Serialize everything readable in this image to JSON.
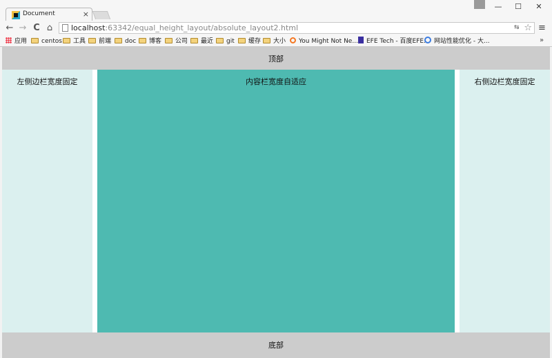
{
  "browser": {
    "tab_title": "Document",
    "tab_close": "×",
    "window_controls": {
      "minimize": "—",
      "maximize": "☐",
      "close": "✕"
    },
    "url_host": "localhost",
    "url_rest": ":63342/equal_height_layout/absolute_layout2.html",
    "nav": {
      "back": "←",
      "forward": "→",
      "reload": "C",
      "home": "⌂"
    },
    "star": "☆",
    "translate": "⇆",
    "menu": "≡",
    "bookmarks_overflow": "»"
  },
  "bookmarks": [
    {
      "label": "应用",
      "icon": "apps-grid-icon"
    },
    {
      "label": "centos",
      "icon": "folder-icon"
    },
    {
      "label": "工具",
      "icon": "folder-icon"
    },
    {
      "label": "前端",
      "icon": "folder-icon"
    },
    {
      "label": "doc",
      "icon": "folder-icon"
    },
    {
      "label": "博客",
      "icon": "folder-icon"
    },
    {
      "label": "公司",
      "icon": "folder-icon"
    },
    {
      "label": "最近",
      "icon": "folder-icon"
    },
    {
      "label": "git",
      "icon": "folder-icon"
    },
    {
      "label": "缓存",
      "icon": "folder-icon"
    },
    {
      "label": "大小",
      "icon": "folder-icon"
    },
    {
      "label": "You Might Not Ne...",
      "icon": "hubspot-icon"
    },
    {
      "label": "EFE Tech - 百度EFE...",
      "icon": "efe-icon"
    },
    {
      "label": "网站性能优化 - 大...",
      "icon": "perf-icon"
    }
  ],
  "page": {
    "header": "顶部",
    "left": "左侧边栏宽度固定",
    "main": "内容栏宽度自适应",
    "right": "右侧边栏宽度固定",
    "footer": "底部"
  },
  "colors": {
    "header_footer": "#cccccc",
    "sidebar": "#dbf0ef",
    "main": "#4ebab1"
  }
}
